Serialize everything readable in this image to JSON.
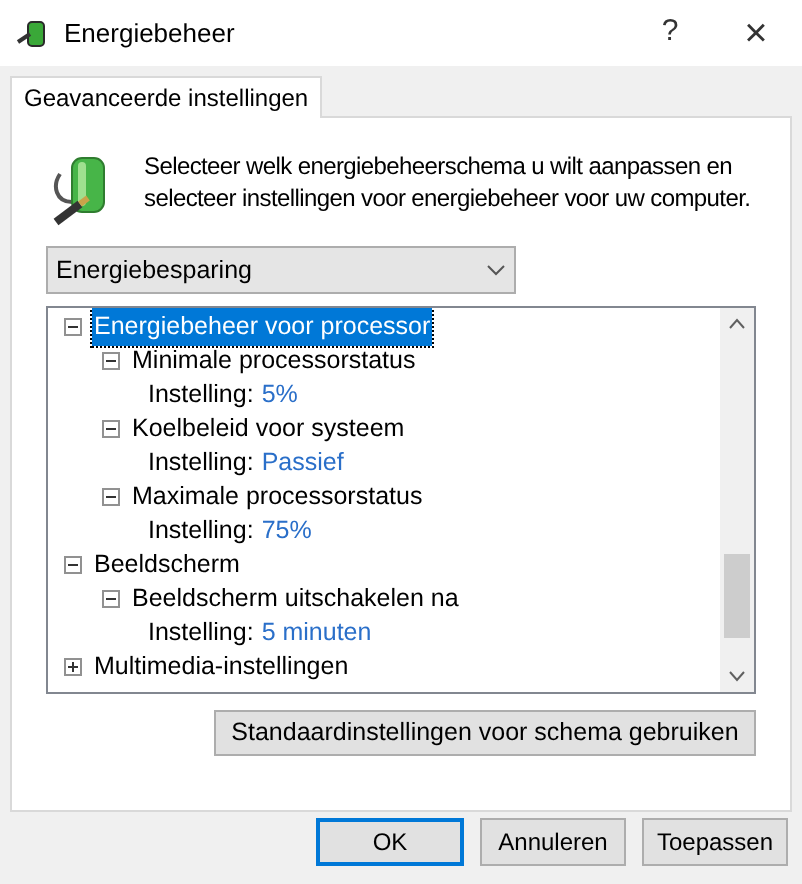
{
  "window": {
    "title": "Energiebeheer",
    "help": "?",
    "close": "×"
  },
  "tabs": [
    {
      "label": "Geavanceerde instellingen",
      "selected": true
    }
  ],
  "description": "Selecteer welk energiebeheerschema u wilt aanpassen en selecteer instellingen voor energiebeheer voor uw computer.",
  "plan_dropdown": {
    "value": "Energiebesparing"
  },
  "tree": [
    {
      "kind": "group",
      "label": "Energiebeheer voor processor",
      "expanded": true,
      "selected": true,
      "children": [
        {
          "kind": "group",
          "label": "Minimale processorstatus",
          "expanded": true,
          "selected": false,
          "children": [
            {
              "kind": "setting",
              "label": "Instelling:",
              "value": "5%"
            }
          ]
        },
        {
          "kind": "group",
          "label": "Koelbeleid voor systeem",
          "expanded": true,
          "selected": false,
          "children": [
            {
              "kind": "setting",
              "label": "Instelling:",
              "value": "Passief"
            }
          ]
        },
        {
          "kind": "group",
          "label": "Maximale processorstatus",
          "expanded": true,
          "selected": false,
          "children": [
            {
              "kind": "setting",
              "label": "Instelling:",
              "value": "75%"
            }
          ]
        }
      ]
    },
    {
      "kind": "group",
      "label": "Beeldscherm",
      "expanded": true,
      "selected": false,
      "children": [
        {
          "kind": "group",
          "label": "Beeldscherm uitschakelen na",
          "expanded": true,
          "selected": false,
          "children": [
            {
              "kind": "setting",
              "label": "Instelling:",
              "value": "5 minuten"
            }
          ]
        }
      ]
    },
    {
      "kind": "group",
      "label": "Multimedia-instellingen",
      "expanded": false,
      "selected": false
    }
  ],
  "restore_button": "Standaardinstellingen voor schema gebruiken",
  "buttons": [
    {
      "label": "OK",
      "default": true
    },
    {
      "label": "Annuleren",
      "default": false
    },
    {
      "label": "Toepassen",
      "default": false
    }
  ]
}
